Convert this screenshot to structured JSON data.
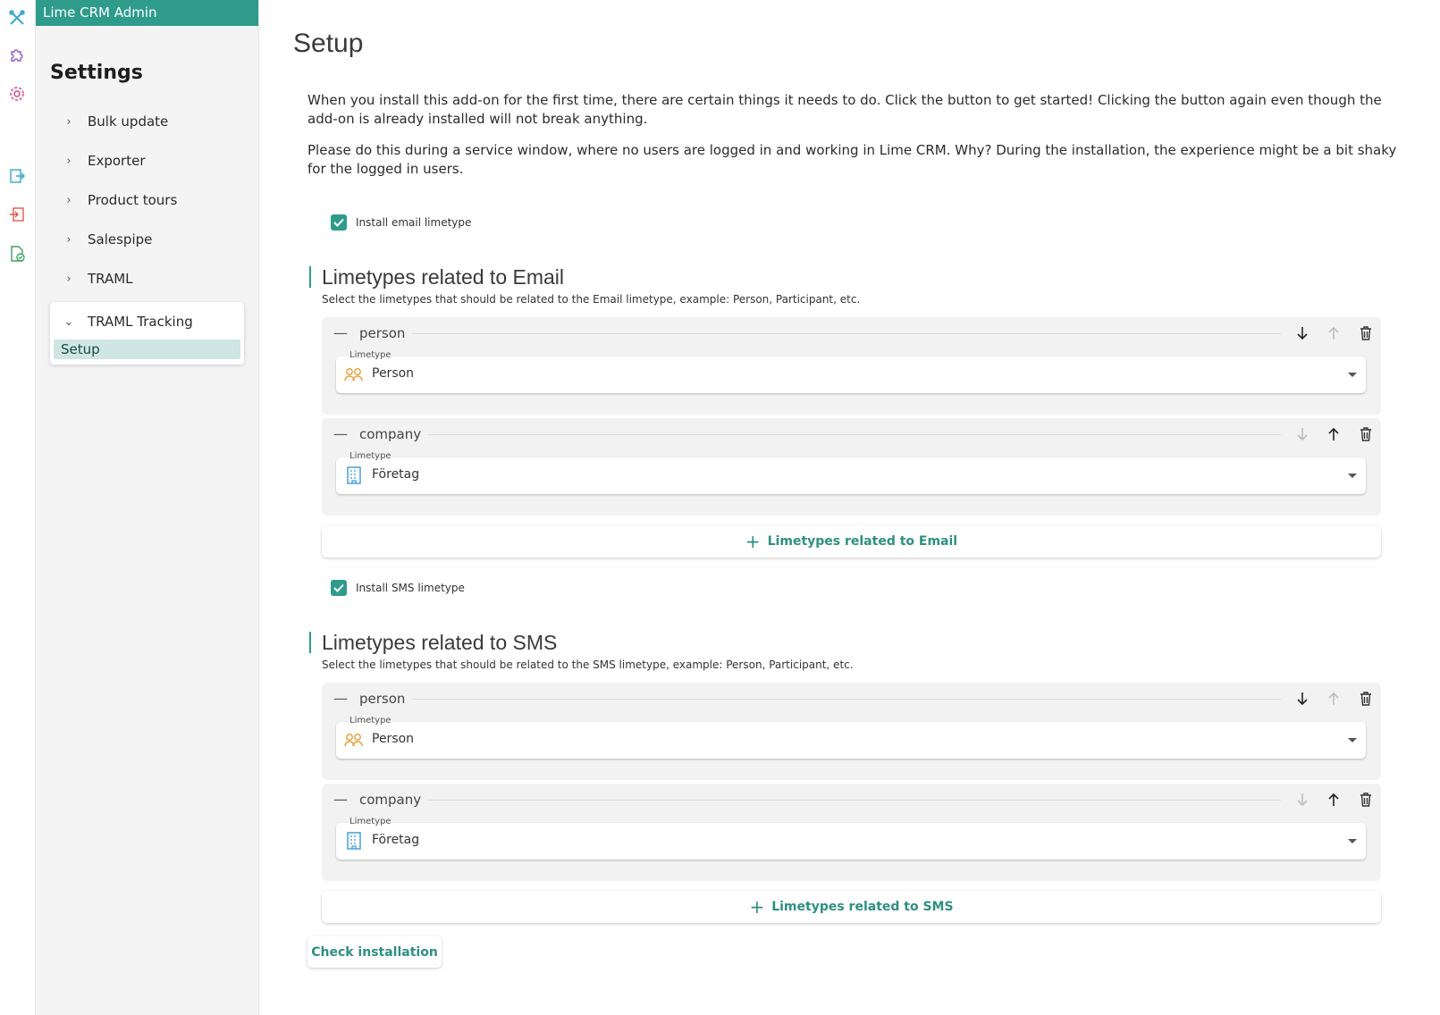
{
  "app": {
    "header": "Lime CRM Admin"
  },
  "sidebar": {
    "title": "Settings",
    "items": [
      {
        "label": "Bulk update"
      },
      {
        "label": "Exporter"
      },
      {
        "label": "Product tours"
      },
      {
        "label": "Salespipe"
      },
      {
        "label": "TRAML"
      }
    ],
    "group": {
      "label": "TRAML Tracking",
      "sub": "Setup"
    }
  },
  "rail_icons": [
    "tools-icon",
    "puzzle-icon",
    "gear-icon",
    "export-icon",
    "import-icon",
    "document-check-icon"
  ],
  "main": {
    "title": "Setup",
    "intro": "When you install this add-on for the first time, there are certain things it needs to do. Click the button to get started! Clicking the button again even though the add-on is already installed will not break anything.",
    "warning": "Please do this during a service window, where no users are logged in and working in Lime CRM. Why? During the installation, the experience might be a bit shaky for the logged in users.",
    "email": {
      "checkbox_label": "Install email limetype",
      "checked": true,
      "section_title": "Limetypes related to Email",
      "section_desc": "Select the limetypes that should be related to the Email limetype, example: Person, Participant, etc.",
      "items": [
        {
          "name": "person",
          "field_label": "Limetype",
          "value": "Person",
          "icon": "person-icon"
        },
        {
          "name": "company",
          "field_label": "Limetype",
          "value": "Företag",
          "icon": "building-icon"
        }
      ],
      "add_label": "Limetypes related to Email"
    },
    "sms": {
      "checkbox_label": "Install SMS limetype",
      "checked": true,
      "section_title": "Limetypes related to SMS",
      "section_desc": "Select the limetypes that should be related to the SMS limetype, example: Person, Participant, etc.",
      "items": [
        {
          "name": "person",
          "field_label": "Limetype",
          "value": "Person",
          "icon": "person-icon"
        },
        {
          "name": "company",
          "field_label": "Limetype",
          "value": "Företag",
          "icon": "building-icon"
        }
      ],
      "add_label": "Limetypes related to SMS"
    },
    "check_button": "Check installation"
  },
  "colors": {
    "accent": "#2e9b8b",
    "person_icon": "#e8a33d",
    "building_icon": "#3a9bd8"
  }
}
